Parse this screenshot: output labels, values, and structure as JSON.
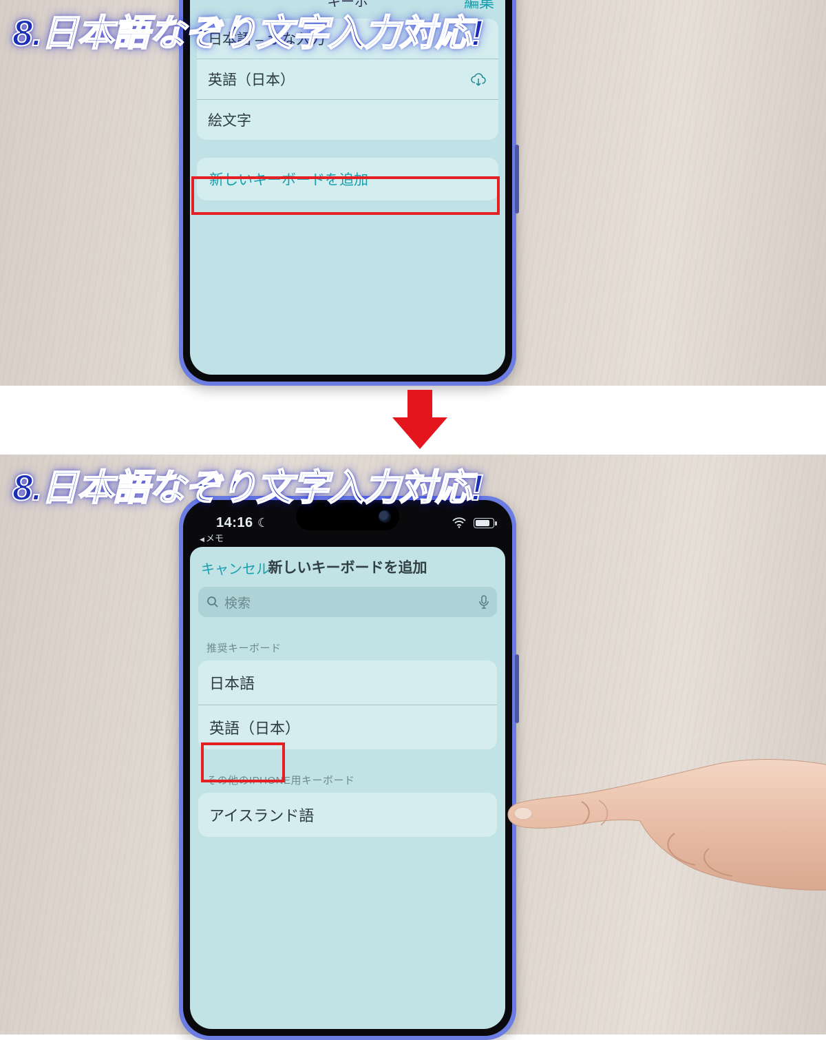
{
  "overlay": {
    "title": "8.日本語なぞり文字入力対応!"
  },
  "top": {
    "nav": {
      "title_fragment": "キーボ",
      "edit": "編集"
    },
    "keyboards": [
      {
        "label": "日本語 – かな入力",
        "has_download": false
      },
      {
        "label": "英語（日本）",
        "has_download": true
      },
      {
        "label": "絵文字",
        "has_download": false
      }
    ],
    "add_row": "新しいキーボードを追加"
  },
  "bottom": {
    "status": {
      "time": "14:16",
      "dnd": "☾",
      "back_app": "メモ"
    },
    "sheet": {
      "cancel": "キャンセル",
      "title": "新しいキーボードを追加",
      "search_placeholder": "検索",
      "section_suggested": "推奨キーボード",
      "suggested": [
        "日本語",
        "英語（日本）"
      ],
      "section_other": "その他のIPHONE用キーボード",
      "other": [
        "アイスランド語"
      ]
    }
  }
}
